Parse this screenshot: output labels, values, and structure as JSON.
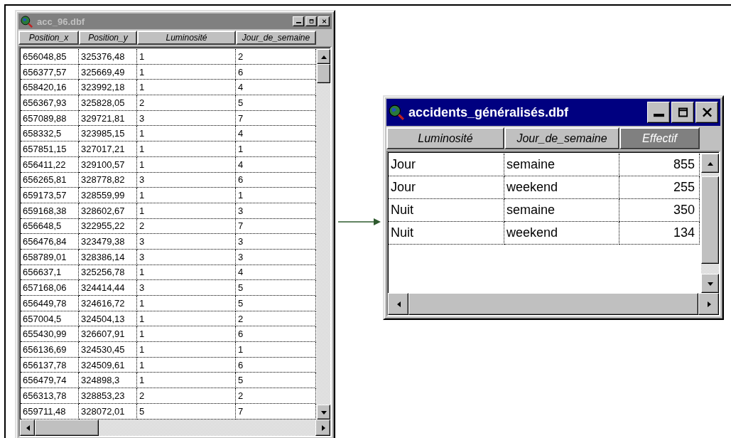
{
  "windows": [
    {
      "title": "acc_96.dbf",
      "active": false,
      "columns": [
        {
          "label": "Position_x",
          "selected": false,
          "kind": "text"
        },
        {
          "label": "Position_y",
          "selected": false,
          "kind": "text"
        },
        {
          "label": "Luminosité",
          "selected": false,
          "kind": "text"
        },
        {
          "label": "Jour_de_semaine",
          "selected": false,
          "kind": "text"
        }
      ],
      "rows": [
        [
          "656048,85",
          "325376,48",
          "1",
          "2"
        ],
        [
          "656377,57",
          "325669,49",
          "1",
          "6"
        ],
        [
          "658420,16",
          "323992,18",
          "1",
          "4"
        ],
        [
          "656367,93",
          "325828,05",
          "2",
          "5"
        ],
        [
          "657089,88",
          "329721,81",
          "3",
          "7"
        ],
        [
          "658332,5",
          "323985,15",
          "1",
          "4"
        ],
        [
          "657851,15",
          "327017,21",
          "1",
          "1"
        ],
        [
          "656411,22",
          "329100,57",
          "1",
          "4"
        ],
        [
          "656265,81",
          "328778,82",
          "3",
          "6"
        ],
        [
          "659173,57",
          "328559,99",
          "1",
          "1"
        ],
        [
          "659168,38",
          "328602,67",
          "1",
          "3"
        ],
        [
          "656648,5",
          "322955,22",
          "2",
          "7"
        ],
        [
          "656476,84",
          "323479,38",
          "3",
          "3"
        ],
        [
          "658789,01",
          "328386,14",
          "3",
          "3"
        ],
        [
          "656637,1",
          "325256,78",
          "1",
          "4"
        ],
        [
          "657168,06",
          "324414,44",
          "3",
          "5"
        ],
        [
          "656449,78",
          "324616,72",
          "1",
          "5"
        ],
        [
          "657004,5",
          "324504,13",
          "1",
          "2"
        ],
        [
          "655430,99",
          "326607,91",
          "1",
          "6"
        ],
        [
          "656136,69",
          "324530,45",
          "1",
          "1"
        ],
        [
          "656137,78",
          "324509,61",
          "1",
          "6"
        ],
        [
          "656479,74",
          "324898,3",
          "1",
          "5"
        ],
        [
          "656313,78",
          "328853,23",
          "2",
          "2"
        ],
        [
          "659711,48",
          "328072,01",
          "5",
          "7"
        ]
      ]
    },
    {
      "title": "accidents_généralisés.dbf",
      "active": true,
      "columns": [
        {
          "label": "Luminosité",
          "selected": false,
          "kind": "text"
        },
        {
          "label": "Jour_de_semaine",
          "selected": false,
          "kind": "text"
        },
        {
          "label": "Effectif",
          "selected": true,
          "kind": "numeric"
        }
      ],
      "rows": [
        [
          "Jour",
          "semaine",
          "855"
        ],
        [
          "Jour",
          "weekend",
          "255"
        ],
        [
          "Nuit",
          "semaine",
          "350"
        ],
        [
          "Nuit",
          "weekend",
          "134"
        ]
      ]
    }
  ]
}
